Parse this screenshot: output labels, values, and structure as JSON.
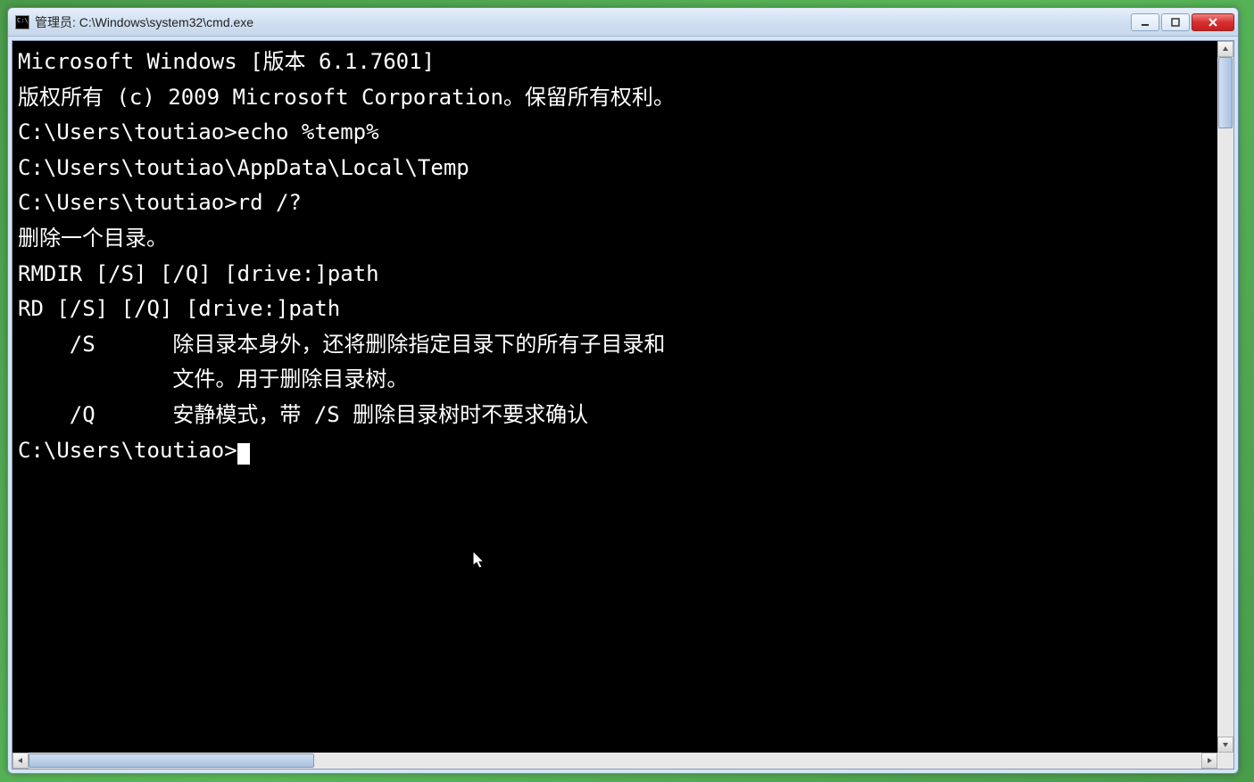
{
  "titlebar": {
    "title": "管理员: C:\\Windows\\system32\\cmd.exe"
  },
  "console": {
    "lines": [
      "Microsoft Windows [版本 6.1.7601]",
      "版权所有 (c) 2009 Microsoft Corporation。保留所有权利。",
      "",
      "C:\\Users\\toutiao>echo %temp%",
      "C:\\Users\\toutiao\\AppData\\Local\\Temp",
      "",
      "C:\\Users\\toutiao>rd /?",
      "删除一个目录。",
      "",
      "RMDIR [/S] [/Q] [drive:]path",
      "RD [/S] [/Q] [drive:]path",
      "",
      "    /S      除目录本身外，还将删除指定目录下的所有子目录和",
      "            文件。用于删除目录树。",
      "",
      "    /Q      安静模式，带 /S 删除目录树时不要求确认",
      "",
      "C:\\Users\\toutiao>"
    ],
    "prompt_cursor": true
  }
}
